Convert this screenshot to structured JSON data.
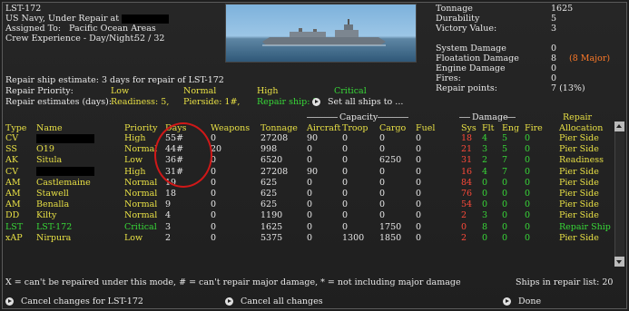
{
  "ship": {
    "name": "LST-172",
    "status": "US Navy, Under Repair at",
    "assigned_label": "Assigned To:",
    "assigned_value": "Pacific Ocean Areas",
    "crew_label": "Crew Experience - Day/Night:",
    "crew_value": "52 / 32"
  },
  "stats": {
    "tonnage_label": "Tonnage",
    "tonnage_value": "1625",
    "durability_label": "Durability",
    "durability_value": "5",
    "victory_label": "Victory Value:",
    "victory_value": "3",
    "sys_label": "System Damage",
    "sys_value": "0",
    "flo_label": "Floatation Damage",
    "flo_value": "8",
    "flo_major": "(8 Major)",
    "eng_label": "Engine Damage",
    "eng_value": "0",
    "fires_label": "Fires:",
    "fires_value": "0",
    "rp_label": "Repair points:",
    "rp_value": "7 (13%)"
  },
  "repair": {
    "estimate": "Repair ship estimate: 3 days for repair of LST-172",
    "priority_label": "Repair Priority:",
    "estimates_label": "Repair estimates (days):",
    "low": "Low",
    "normal": "Normal",
    "high": "High",
    "critical": "Critical",
    "readiness": "Readiness: 5,",
    "pierside": "Pierside: 1#,",
    "repairship": "Repair ship: 3",
    "set_all": "Set all ships to ..."
  },
  "headers": {
    "capacity": "Capacity",
    "damage": "Damage",
    "repair_top": "Repair",
    "type": "Type",
    "name": "Name",
    "priority": "Priority",
    "days": "Days",
    "weapons": "Weapons",
    "tonnage": "Tonnage",
    "aircraft": "Aircraft",
    "troop": "Troop",
    "cargo": "Cargo",
    "fuel": "Fuel",
    "sys": "Sys",
    "flt": "Flt",
    "eng": "Eng",
    "fire": "Fire",
    "allocation": "Allocation"
  },
  "rows": [
    {
      "type": "CV",
      "name": "",
      "priority": "High",
      "days": "55#",
      "weapons": "0",
      "tonnage": "27208",
      "aircraft": "90",
      "troop": "0",
      "cargo": "0",
      "fuel": "0",
      "sys": "18",
      "flt": "4",
      "eng": "5",
      "fire": "0",
      "alloc": "Pier Side"
    },
    {
      "type": "SS",
      "name": "O19",
      "priority": "Normal",
      "days": "44#",
      "weapons": "20",
      "tonnage": "998",
      "aircraft": "0",
      "troop": "0",
      "cargo": "0",
      "fuel": "0",
      "sys": "21",
      "flt": "3",
      "eng": "5",
      "fire": "0",
      "alloc": "Pier Side"
    },
    {
      "type": "AK",
      "name": "Situla",
      "priority": "Low",
      "days": "36#",
      "weapons": "0",
      "tonnage": "6520",
      "aircraft": "0",
      "troop": "0",
      "cargo": "6250",
      "fuel": "0",
      "sys": "31",
      "flt": "2",
      "eng": "7",
      "fire": "0",
      "alloc": "Readiness"
    },
    {
      "type": "CV",
      "name": "",
      "priority": "High",
      "days": "31#",
      "weapons": "0",
      "tonnage": "27208",
      "aircraft": "90",
      "troop": "0",
      "cargo": "0",
      "fuel": "0",
      "sys": "16",
      "flt": "4",
      "eng": "7",
      "fire": "0",
      "alloc": "Pier Side"
    },
    {
      "type": "AM",
      "name": "Castlemaine",
      "priority": "Normal",
      "days": "19",
      "weapons": "0",
      "tonnage": "625",
      "aircraft": "0",
      "troop": "0",
      "cargo": "0",
      "fuel": "0",
      "sys": "84",
      "flt": "0",
      "eng": "0",
      "fire": "0",
      "alloc": "Pier Side"
    },
    {
      "type": "AM",
      "name": "Stawell",
      "priority": "Normal",
      "days": "18",
      "weapons": "0",
      "tonnage": "625",
      "aircraft": "0",
      "troop": "0",
      "cargo": "0",
      "fuel": "0",
      "sys": "76",
      "flt": "0",
      "eng": "0",
      "fire": "0",
      "alloc": "Pier Side"
    },
    {
      "type": "AM",
      "name": "Benalla",
      "priority": "Normal",
      "days": "9",
      "weapons": "0",
      "tonnage": "625",
      "aircraft": "0",
      "troop": "0",
      "cargo": "0",
      "fuel": "0",
      "sys": "54",
      "flt": "0",
      "eng": "0",
      "fire": "0",
      "alloc": "Pier Side"
    },
    {
      "type": "DD",
      "name": "Kilty",
      "priority": "Normal",
      "days": "4",
      "weapons": "0",
      "tonnage": "1190",
      "aircraft": "0",
      "troop": "0",
      "cargo": "0",
      "fuel": "0",
      "sys": "2",
      "flt": "3",
      "eng": "0",
      "fire": "0",
      "alloc": "Pier Side"
    },
    {
      "type": "LST",
      "name": "LST-172",
      "priority": "Critical",
      "days": "3",
      "weapons": "0",
      "tonnage": "1625",
      "aircraft": "0",
      "troop": "0",
      "cargo": "1750",
      "fuel": "0",
      "sys": "0",
      "flt": "8",
      "eng": "0",
      "fire": "0",
      "alloc": "Repair Ship"
    },
    {
      "type": "xAP",
      "name": "Nirpura",
      "priority": "Low",
      "days": "2",
      "weapons": "0",
      "tonnage": "5375",
      "aircraft": "0",
      "troop": "1300",
      "cargo": "1850",
      "fuel": "0",
      "sys": "2",
      "flt": "0",
      "eng": "0",
      "fire": "0",
      "alloc": "Pier Side"
    }
  ],
  "footer": {
    "legend": "X = can't be repaired under this mode, # = can't repair major damage, * = not including major damage",
    "ships_in_list": "Ships in repair list: 20",
    "cancel_ship": "Cancel changes for LST-172",
    "cancel_all": "Cancel all changes",
    "done": "Done"
  },
  "colors": {
    "yellow": "#e8e045",
    "green": "#38d838",
    "orange": "#ff7a28",
    "red": "#ff4a3a",
    "circle": "#d01818"
  }
}
